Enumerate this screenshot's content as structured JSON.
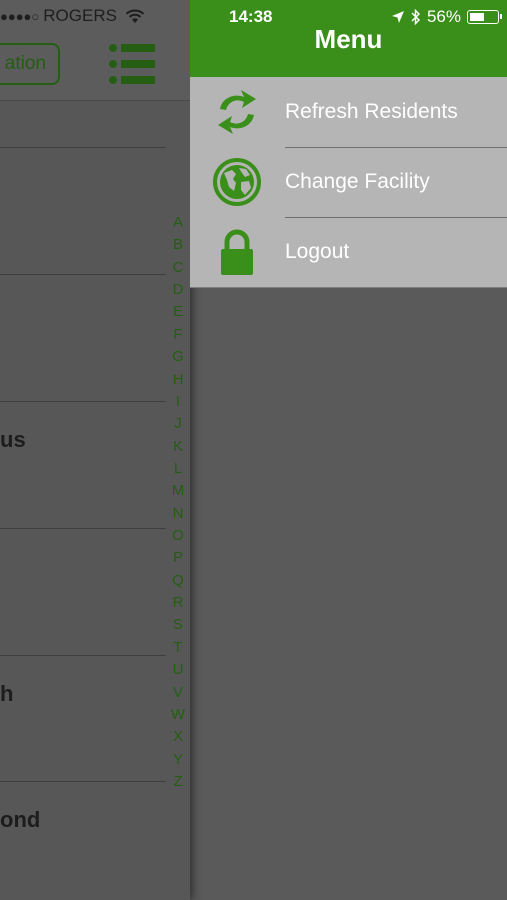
{
  "status_bar": {
    "signal_dots": "●●●●○",
    "carrier": "ROGERS",
    "time": "14:38",
    "battery": "56%",
    "battery_level": 0.56
  },
  "background_list": {
    "location_button_label": "ation",
    "partial_names": [
      "us",
      "h",
      "ond"
    ],
    "index_letters": [
      "A",
      "B",
      "C",
      "D",
      "E",
      "F",
      "G",
      "H",
      "I",
      "J",
      "K",
      "L",
      "M",
      "N",
      "O",
      "P",
      "Q",
      "R",
      "S",
      "T",
      "U",
      "V",
      "W",
      "X",
      "Y",
      "Z"
    ]
  },
  "menu": {
    "title": "Menu",
    "items": [
      {
        "label": "Refresh Residents",
        "icon": "refresh-icon"
      },
      {
        "label": "Change Facility",
        "icon": "globe-icon"
      },
      {
        "label": "Logout",
        "icon": "lock-icon"
      }
    ]
  },
  "colors": {
    "accent_green": "#3a8e1a",
    "dark_green": "#245e12",
    "menu_background": "#b5b5b5",
    "overlay": "#5a5a5a"
  }
}
